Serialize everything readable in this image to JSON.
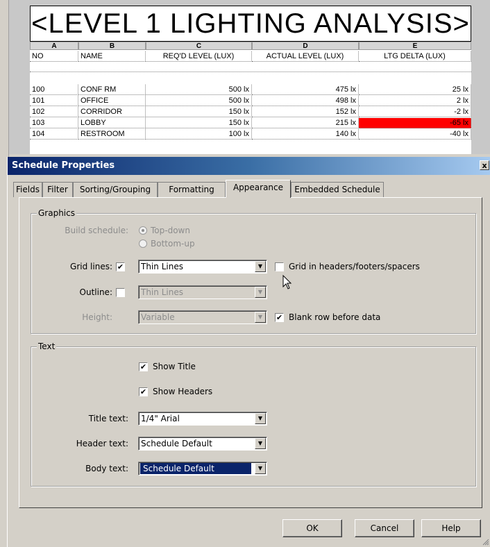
{
  "schedule": {
    "title": "<LEVEL 1 LIGHTING ANALYSIS>",
    "column_letters": [
      "A",
      "B",
      "C",
      "D",
      "E"
    ],
    "headers": [
      "NO",
      "NAME",
      "REQ'D LEVEL (LUX)",
      "ACTUAL LEVEL (LUX)",
      "LTG DELTA (LUX)"
    ],
    "rows": [
      {
        "no": "100",
        "name": "CONF RM",
        "reqd": "500 lx",
        "actual": "475 lx",
        "delta": "25 lx"
      },
      {
        "no": "101",
        "name": "OFFICE",
        "reqd": "500 lx",
        "actual": "498 lx",
        "delta": "2 lx"
      },
      {
        "no": "102",
        "name": "CORRIDOR",
        "reqd": "150 lx",
        "actual": "152 lx",
        "delta": "-2 lx"
      },
      {
        "no": "103",
        "name": "LOBBY",
        "reqd": "150 lx",
        "actual": "215 lx",
        "delta": "-65 lx"
      },
      {
        "no": "104",
        "name": "RESTROOM",
        "reqd": "100 lx",
        "actual": "140 lx",
        "delta": "-40 lx"
      }
    ],
    "highlight_color": "#ff0000"
  },
  "dialog": {
    "title": "Schedule Properties",
    "close_glyph": "x",
    "tabs": [
      "Fields",
      "Filter",
      "Sorting/Grouping",
      "Formatting",
      "Appearance",
      "Embedded Schedule"
    ],
    "active_tab": "Appearance",
    "graphics": {
      "group_label": "Graphics",
      "build_schedule_label": "Build schedule:",
      "top_down": "Top-down",
      "bottom_up": "Bottom-up",
      "grid_lines_label": "Grid lines:",
      "grid_lines_checked": true,
      "grid_lines_value": "Thin Lines",
      "grid_in_headers_label": "Grid in headers/footers/spacers",
      "grid_in_headers_checked": false,
      "outline_label": "Outline:",
      "outline_checked": false,
      "outline_value": "Thin Lines",
      "height_label": "Height:",
      "height_value": "Variable",
      "blank_row_label": "Blank row before data",
      "blank_row_checked": true
    },
    "text": {
      "group_label": "Text",
      "show_title": "Show Title",
      "show_title_checked": true,
      "show_headers": "Show Headers",
      "show_headers_checked": true,
      "title_text_label": "Title text:",
      "title_text_value": "1/4\" Arial",
      "header_text_label": "Header text:",
      "header_text_value": "Schedule Default",
      "body_text_label": "Body text:",
      "body_text_value": "Schedule Default"
    },
    "buttons": {
      "ok": "OK",
      "cancel": "Cancel",
      "help": "Help"
    }
  }
}
